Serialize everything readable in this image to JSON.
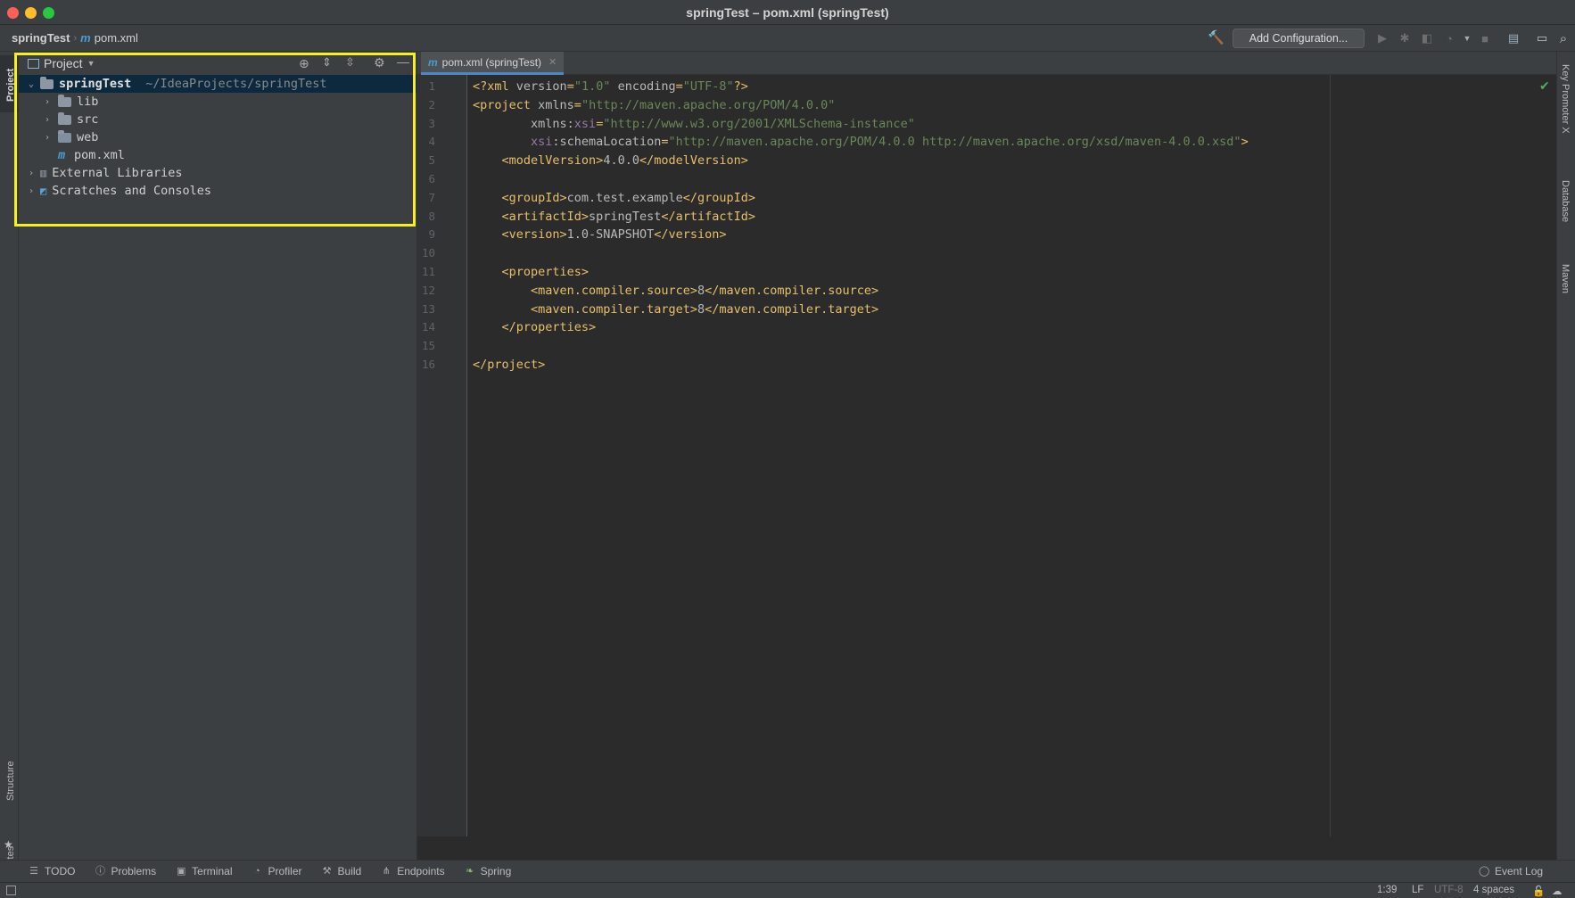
{
  "window": {
    "title": "springTest – pom.xml (springTest)"
  },
  "navbar": {
    "project": "springTest",
    "file": "pom.xml",
    "add_configuration": "Add Configuration..."
  },
  "left_stripe": {
    "project": "Project",
    "structure": "Structure",
    "favorites": "Favorites"
  },
  "right_stripe": {
    "key_promoter": "Key Promoter X",
    "database": "Database",
    "maven": "Maven"
  },
  "project_panel": {
    "title": "Project",
    "tree": [
      {
        "label": "springTest",
        "path": "~/IdeaProjects/springTest"
      },
      {
        "label": "lib"
      },
      {
        "label": "src"
      },
      {
        "label": "web"
      },
      {
        "label": "pom.xml"
      },
      {
        "label": "External Libraries"
      },
      {
        "label": "Scratches and Consoles"
      }
    ]
  },
  "editor": {
    "tab": "pom.xml (springTest)",
    "line_numbers": [
      "1",
      "2",
      "3",
      "4",
      "5",
      "6",
      "7",
      "8",
      "9",
      "10",
      "11",
      "12",
      "13",
      "14",
      "15",
      "16"
    ],
    "lines": [
      [
        [
          "tag",
          "<?xml "
        ],
        [
          "attr",
          "version"
        ],
        [
          "tag",
          "="
        ],
        [
          "val",
          "\"1.0\""
        ],
        [
          "attr",
          " encoding"
        ],
        [
          "tag",
          "="
        ],
        [
          "val",
          "\"UTF-8\""
        ],
        [
          "tag",
          "?>"
        ]
      ],
      [
        [
          "tag",
          "<project "
        ],
        [
          "attr",
          "xmlns"
        ],
        [
          "tag",
          "="
        ],
        [
          "val",
          "\"http://maven.apache.org/POM/4.0.0\""
        ]
      ],
      [
        [
          "attr",
          "        xmlns:"
        ],
        [
          "ns",
          "xsi"
        ],
        [
          "tag",
          "="
        ],
        [
          "val",
          "\"http://www.w3.org/2001/XMLSchema-instance\""
        ]
      ],
      [
        [
          "ns",
          "        xsi"
        ],
        [
          "attr",
          ":schemaLocation"
        ],
        [
          "tag",
          "="
        ],
        [
          "val",
          "\"http://maven.apache.org/POM/4.0.0 http://maven.apache.org/xsd/maven-4.0.0.xsd\""
        ],
        [
          "tag",
          ">"
        ]
      ],
      [
        [
          "tag",
          "    <modelVersion>"
        ],
        [
          "attr",
          "4.0.0"
        ],
        [
          "tag",
          "</modelVersion>"
        ]
      ],
      [],
      [
        [
          "tag",
          "    <groupId>"
        ],
        [
          "attr",
          "com.test.example"
        ],
        [
          "tag",
          "</groupId>"
        ]
      ],
      [
        [
          "tag",
          "    <artifactId>"
        ],
        [
          "attr",
          "springTest"
        ],
        [
          "tag",
          "</artifactId>"
        ]
      ],
      [
        [
          "tag",
          "    <version>"
        ],
        [
          "attr",
          "1.0-SNAPSHOT"
        ],
        [
          "tag",
          "</version>"
        ]
      ],
      [],
      [
        [
          "tag",
          "    <properties>"
        ]
      ],
      [
        [
          "tag",
          "        <maven.compiler.source>"
        ],
        [
          "attr",
          "8"
        ],
        [
          "tag",
          "</maven.compiler.source>"
        ]
      ],
      [
        [
          "tag",
          "        <maven.compiler.target>"
        ],
        [
          "attr",
          "8"
        ],
        [
          "tag",
          "</maven.compiler.target>"
        ]
      ],
      [
        [
          "tag",
          "    </properties>"
        ]
      ],
      [],
      [
        [
          "tag",
          "</project>"
        ]
      ]
    ]
  },
  "bottom_tools": [
    "TODO",
    "Problems",
    "Terminal",
    "Profiler",
    "Build",
    "Endpoints",
    "Spring"
  ],
  "event_log": "Event Log",
  "status": {
    "position": "1:39",
    "line_sep": "LF",
    "encoding": "UTF-8",
    "indent": "4 spaces"
  },
  "colors": {
    "highlight": "#f5f01e",
    "tab_accent": "#4a88c7"
  }
}
